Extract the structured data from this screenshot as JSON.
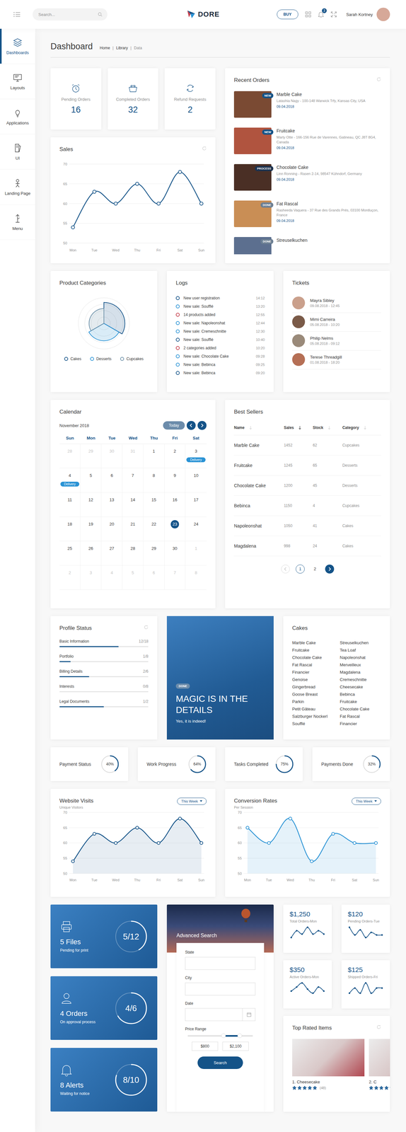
{
  "topnav": {
    "search": {
      "placeholder": "Search..."
    },
    "logo": "DORE",
    "buy": "BUY",
    "notifications": "3",
    "user": "Sarah Kortney"
  },
  "sidebar": {
    "items": [
      {
        "label": "Dashboards",
        "selected": true
      },
      {
        "label": "Layouts",
        "selected": false
      },
      {
        "label": "Applications",
        "selected": false
      },
      {
        "label": "UI",
        "selected": false
      },
      {
        "label": "Landing Page",
        "selected": false
      },
      {
        "label": "Menu",
        "selected": false
      }
    ]
  },
  "page": {
    "title": "Dashboard",
    "separator": "|",
    "breadcrumbs": [
      {
        "label": "Home",
        "selected": false
      },
      {
        "label": "Library",
        "selected": false
      },
      {
        "label": "Data",
        "selected": true
      }
    ]
  },
  "stats": [
    {
      "label": "Pending Orders",
      "value": "16"
    },
    {
      "label": "Completed Orders",
      "value": "32"
    },
    {
      "label": "Refund Requests",
      "value": "2"
    }
  ],
  "sales": {
    "title": "Sales",
    "y_ticks": [
      "70",
      "65",
      "60",
      "55",
      "50"
    ],
    "x_labels": [
      "Mon",
      "Tue",
      "Wed",
      "Thu",
      "Fri",
      "Sat",
      "Sun"
    ],
    "values": [
      54,
      63,
      60,
      65,
      60,
      68,
      60
    ]
  },
  "recent_orders": {
    "title": "Recent Orders",
    "items": [
      {
        "name": "Marble Cake",
        "badge": "NEW",
        "badge_color": "#145388",
        "address": "Latashia Nagy - 100-148 Warwick Trfy, Kansas City, USA",
        "date": "09.04.2018"
      },
      {
        "name": "Fruitcake",
        "badge": "NEW",
        "badge_color": "#145388",
        "address": "Marty Otte - 166-156 Rue de Varennes, Gatineau, QC J8T 8G4, Canada",
        "date": "09.04.2018"
      },
      {
        "name": "Chocolate Cake",
        "badge": "PROCESS",
        "badge_color": "#1c3350",
        "address": "Linn Ronning - Rasen 2-14, 98547 Kühndorf, Germany",
        "date": "09.04.2018"
      },
      {
        "name": "Fat Rascal",
        "badge": "DONE",
        "badge_color": "#6c7f93",
        "address": "Rasheeda Vaquera - 37 Rue des Grands Prés, 03100 Montluçon, France",
        "date": "09.04.2018"
      },
      {
        "name": "Streuselkuchen",
        "badge": "DONE",
        "badge_color": "#6c7f93"
      }
    ]
  },
  "product_categories": {
    "title": "Product Categories",
    "legend": [
      {
        "label": "Cakes",
        "color": "#145388",
        "value": 82
      },
      {
        "label": "Desserts",
        "color": "#2a93d5",
        "value": 68
      },
      {
        "label": "Cupcakes",
        "color": "#6c90a8",
        "value": 58
      }
    ]
  },
  "logs": {
    "title": "Logs",
    "items": [
      {
        "text": "New user registration",
        "time": "14:12",
        "color": "#145388"
      },
      {
        "text": "New sale: Soufflé",
        "time": "13:20",
        "color": "#2a93d5"
      },
      {
        "text": "14 products added",
        "time": "12:55",
        "color": "#c43d4b"
      },
      {
        "text": "New sale: Napoleonshat",
        "time": "12:44",
        "color": "#2a93d5"
      },
      {
        "text": "New sale: Cremeschnitte",
        "time": "12:30",
        "color": "#2a93d5"
      },
      {
        "text": "New sale: Soufflé",
        "time": "10:40",
        "color": "#145388"
      },
      {
        "text": "2 categories added",
        "time": "10:20",
        "color": "#c43d4b"
      },
      {
        "text": "New sale: Chocolate Cake",
        "time": "09:28",
        "color": "#2a93d5"
      },
      {
        "text": "New sale: Bebinca",
        "time": "09:25",
        "color": "#2a93d5"
      },
      {
        "text": "New sale: Bebinca",
        "time": "09:20",
        "color": "#145388"
      }
    ]
  },
  "tickets": {
    "title": "Tickets",
    "items": [
      {
        "name": "Mayra Sibley",
        "date": "09.08.2018 - 12:45"
      },
      {
        "name": "Mimi Carreira",
        "date": "05.08.2018 - 10:20"
      },
      {
        "name": "Philip Nelms",
        "date": "05.08.2018 - 09:12"
      },
      {
        "name": "Terese Threadgill",
        "date": "01.08.2018 - 18:20"
      }
    ]
  },
  "calendar": {
    "title": "Calendar",
    "month": "November 2018",
    "today": "Today",
    "weekdays": [
      "Sun",
      "Mon",
      "Tue",
      "Wed",
      "Thu",
      "Fri",
      "Sat"
    ],
    "days": [
      {
        "day": "28",
        "muted": true,
        "selected": false,
        "events": []
      },
      {
        "day": "29",
        "muted": true,
        "selected": false,
        "events": []
      },
      {
        "day": "30",
        "muted": true,
        "selected": false,
        "events": []
      },
      {
        "day": "31",
        "muted": true,
        "selected": false,
        "events": []
      },
      {
        "day": "1",
        "muted": false,
        "selected": false,
        "events": []
      },
      {
        "day": "2",
        "muted": false,
        "selected": false,
        "events": []
      },
      {
        "day": "3",
        "muted": false,
        "selected": false,
        "events": [
          {
            "label": "Delivery"
          }
        ]
      },
      {
        "day": "4",
        "muted": false,
        "selected": false,
        "events": [
          {
            "label": "Delivery"
          }
        ]
      },
      {
        "day": "5",
        "muted": false,
        "selected": false,
        "events": []
      },
      {
        "day": "6",
        "muted": false,
        "selected": false,
        "events": []
      },
      {
        "day": "7",
        "muted": false,
        "selected": false,
        "events": []
      },
      {
        "day": "8",
        "muted": false,
        "selected": false,
        "events": []
      },
      {
        "day": "9",
        "muted": false,
        "selected": false,
        "events": []
      },
      {
        "day": "10",
        "muted": false,
        "selected": false,
        "events": []
      },
      {
        "day": "11",
        "muted": false,
        "selected": false,
        "events": []
      },
      {
        "day": "12",
        "muted": false,
        "selected": false,
        "events": []
      },
      {
        "day": "13",
        "muted": false,
        "selected": false,
        "events": []
      },
      {
        "day": "14",
        "muted": false,
        "selected": false,
        "events": []
      },
      {
        "day": "15",
        "muted": false,
        "selected": false,
        "events": []
      },
      {
        "day": "16",
        "muted": false,
        "selected": false,
        "events": []
      },
      {
        "day": "17",
        "muted": false,
        "selected": false,
        "events": []
      },
      {
        "day": "18",
        "muted": false,
        "selected": false,
        "events": []
      },
      {
        "day": "19",
        "muted": false,
        "selected": false,
        "events": []
      },
      {
        "day": "20",
        "muted": false,
        "selected": false,
        "events": []
      },
      {
        "day": "21",
        "muted": false,
        "selected": false,
        "events": []
      },
      {
        "day": "22",
        "muted": false,
        "selected": false,
        "events": []
      },
      {
        "day": "23",
        "muted": false,
        "selected": true,
        "events": []
      },
      {
        "day": "24",
        "muted": false,
        "selected": false,
        "events": []
      },
      {
        "day": "25",
        "muted": false,
        "selected": false,
        "events": []
      },
      {
        "day": "26",
        "muted": false,
        "selected": false,
        "events": []
      },
      {
        "day": "27",
        "muted": false,
        "selected": false,
        "events": []
      },
      {
        "day": "28",
        "muted": false,
        "selected": false,
        "events": []
      },
      {
        "day": "29",
        "muted": false,
        "selected": false,
        "events": []
      },
      {
        "day": "30",
        "muted": false,
        "selected": false,
        "events": []
      },
      {
        "day": "1",
        "muted": true,
        "selected": false,
        "events": []
      },
      {
        "day": "2",
        "muted": true,
        "selected": false,
        "events": []
      },
      {
        "day": "3",
        "muted": true,
        "selected": false,
        "events": []
      },
      {
        "day": "4",
        "muted": true,
        "selected": false,
        "events": []
      },
      {
        "day": "5",
        "muted": true,
        "selected": false,
        "events": []
      },
      {
        "day": "6",
        "muted": true,
        "selected": false,
        "events": []
      },
      {
        "day": "7",
        "muted": true,
        "selected": false,
        "events": []
      },
      {
        "day": "8",
        "muted": true,
        "selected": false,
        "events": []
      }
    ]
  },
  "best_sellers": {
    "title": "Best Sellers",
    "columns": [
      {
        "label": "Name",
        "sorted": false
      },
      {
        "label": "Sales",
        "sorted": true
      },
      {
        "label": "Stock",
        "sorted": false
      },
      {
        "label": "Category",
        "sorted": false
      }
    ],
    "rows": [
      [
        "Marble Cake",
        "1452",
        "62",
        "Cupcakes"
      ],
      [
        "Fruitcake",
        "1245",
        "65",
        "Desserts"
      ],
      [
        "Chocolate Cake",
        "1200",
        "45",
        "Desserts"
      ],
      [
        "Bebinca",
        "1150",
        "4",
        "Cupcakes"
      ],
      [
        "Napoleonshat",
        "1050",
        "41",
        "Cakes"
      ],
      [
        "Magdalena",
        "998",
        "24",
        "Cakes"
      ]
    ],
    "pages": [
      {
        "label": "1",
        "selected": true
      },
      {
        "label": "2",
        "selected": false
      }
    ]
  },
  "profile_status": {
    "title": "Profile Status",
    "items": [
      {
        "label": "Basic Information",
        "value": "12/18",
        "level": 0.667
      },
      {
        "label": "Portfolio",
        "value": "1/8",
        "level": 0.125
      },
      {
        "label": "Billing Details",
        "value": "2/6",
        "level": 0.333
      },
      {
        "label": "Interests",
        "value": "0/8",
        "level": 0
      },
      {
        "label": "Legal Documents",
        "value": "1/2",
        "level": 0.5
      }
    ]
  },
  "feature": {
    "badge": "DONE",
    "title": "MAGIC IS IN THE DETAILS",
    "subtitle": "Yes, it is indeed!"
  },
  "cakes": {
    "title": "Cakes",
    "items": [
      "Marble Cake",
      "Fruitcake",
      "Chocolate Cake",
      "Fat Rascal",
      "Financier",
      "Genoise",
      "Gingerbread",
      "Goose Breast",
      "Parkin",
      "Petit Gâteau",
      "Salzburger Nockerl",
      "Soufflé",
      "Streuselkuchen",
      "Tea Loaf",
      "Napoleonshat",
      "Merveilleux",
      "Magdalena",
      "Cremeschnitte",
      "Cheesecake",
      "Bebinca",
      "Fruitcake",
      "Chocolate Cake",
      "Fat Rascal",
      "Financier"
    ]
  },
  "progress": [
    {
      "label": "Payment Status",
      "reading": "40%",
      "level": 0.4
    },
    {
      "label": "Work Progress",
      "reading": "64%",
      "level": 0.64
    },
    {
      "label": "Tasks Completed",
      "reading": "75%",
      "level": 0.75
    },
    {
      "label": "Payments Done",
      "reading": "32%",
      "level": 0.32
    }
  ],
  "website_visits": {
    "title": "Website Visits",
    "subtitle": "Unique Visitors",
    "filter": "This Week",
    "y_ticks": [
      "70",
      "65",
      "60",
      "55",
      "50"
    ],
    "x_labels": [
      "Mon",
      "Tue",
      "Wed",
      "Thu",
      "Fri",
      "Sat",
      "Sun"
    ],
    "values": [
      54,
      63,
      60,
      65,
      60,
      68,
      60
    ]
  },
  "conversion_rates": {
    "title": "Conversion Rates",
    "subtitle": "Per Session",
    "filter": "This Week",
    "y_ticks": [
      "70",
      "65",
      "60",
      "55",
      "50"
    ],
    "x_labels": [
      "Mon",
      "Tue",
      "Wed",
      "Thu",
      "Fri",
      "Sat",
      "Sun"
    ],
    "values": [
      65,
      60,
      68,
      54,
      63,
      60,
      60
    ]
  },
  "tasks": [
    {
      "title": "5 Files",
      "subtitle": "Pending for print",
      "reading": "5/12",
      "level": 0.417
    },
    {
      "title": "4 Orders",
      "subtitle": "On approval process",
      "reading": "4/6",
      "level": 0.667
    },
    {
      "title": "8 Alerts",
      "subtitle": "Waiting for notice",
      "reading": "8/10",
      "level": 0.8
    }
  ],
  "search": {
    "title": "Advanced Search",
    "fields": [
      {
        "label": "State",
        "kind": "text"
      },
      {
        "label": "City",
        "kind": "text"
      },
      {
        "label": "Date",
        "kind": "date"
      }
    ],
    "price": {
      "label": "Price Range",
      "low": "$800",
      "high": "$2,100",
      "level_low": 0.55,
      "level_high": 0.8
    },
    "button": "Search"
  },
  "mini_cards": [
    {
      "value": "$1,250",
      "label": "Total Orders-Mon",
      "values": [
        4,
        6,
        5,
        7,
        5,
        6,
        5
      ]
    },
    {
      "value": "$120",
      "label": "Pending Orders-Tue",
      "values": [
        6,
        3,
        5,
        2,
        4,
        3,
        3
      ]
    },
    {
      "value": "$350",
      "label": "Active Orders-Mon",
      "values": [
        3,
        5,
        7,
        4,
        2,
        5,
        3
      ]
    },
    {
      "value": "$125",
      "label": "Shipped Orders-Fri",
      "values": [
        3,
        4,
        3,
        5,
        3,
        4,
        4
      ]
    }
  ],
  "top_rated": {
    "title": "Top Rated Items",
    "items": [
      {
        "name": "1. Cheesecake",
        "stars": 5,
        "count": "(48)"
      },
      {
        "name": "2. C",
        "stars": 5,
        "count": ""
      }
    ]
  }
}
